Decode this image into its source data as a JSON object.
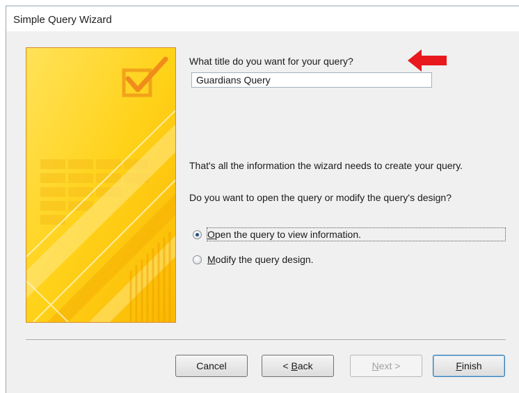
{
  "window": {
    "title": "Simple Query Wizard"
  },
  "prompt": {
    "text": "What title do you want for your query?"
  },
  "query_title_input": {
    "value": "Guardians Query"
  },
  "info": {
    "line1": "That's all the information the wizard needs to create your query.",
    "line2": "Do you want to open the query or modify the query's design?"
  },
  "options": [
    {
      "label_key": "O",
      "label_rest": "pen the query to view information.",
      "checked": true
    },
    {
      "label_key": "M",
      "label_rest": "odify the query design.",
      "checked": false
    }
  ],
  "buttons": {
    "cancel": "Cancel",
    "back_prefix": "< ",
    "back_key": "B",
    "back_rest": "ack",
    "next_key": "N",
    "next_rest": "ext >",
    "finish_key": "F",
    "finish_rest": "inish"
  },
  "colors": {
    "annotation_arrow": "#e8181c",
    "panel_yellow": "#ffd21a",
    "panel_border": "#d58a2a"
  },
  "icons": {
    "annotation": "red-arrow-icon",
    "panel_decoration": "checkbox-check-icon"
  }
}
